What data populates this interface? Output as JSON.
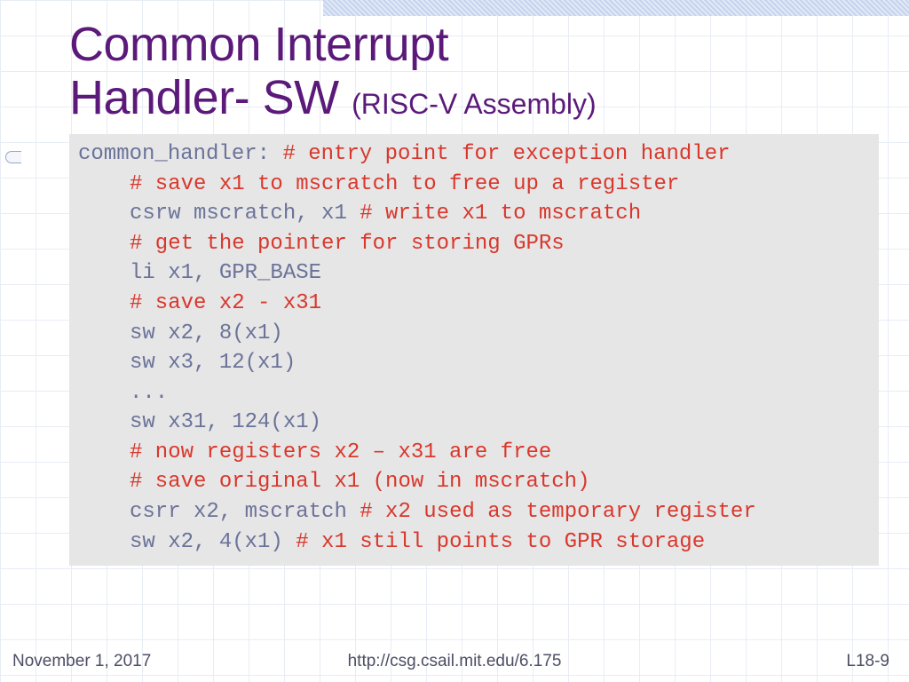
{
  "title": {
    "line1": "Common Interrupt",
    "line2_main": "Handler- SW ",
    "line2_sub": "(RISC-V Assembly)"
  },
  "code": {
    "l1_label": "common_handler: ",
    "l1_cmt": "# entry point for exception handler",
    "l2_cmt": "# save x1 to mscratch to free up a register",
    "l3_instr": "csrw mscratch, x1 ",
    "l3_cmt": "# write x1 to mscratch",
    "l4_cmt": "# get the pointer for storing GPRs",
    "l5_instr": "li x1, GPR_BASE",
    "l6_cmt": "# save x2 - x31",
    "l7_instr": "sw x2, 8(x1)",
    "l8_instr": "sw x3, 12(x1)",
    "l9_instr": "...",
    "l10_instr": "sw x31, 124(x1)",
    "l11_cmt": "# now registers x2 – x31 are free",
    "l12_cmt": "# save original x1 (now in mscratch)",
    "l13_instr": "csrr x2, mscratch ",
    "l13_cmt": "# x2 used as temporary register",
    "l14_instr": "sw x2, 4(x1) ",
    "l14_cmt": "# x1 still points to GPR storage"
  },
  "footer": {
    "date": "November 1, 2017",
    "url": "http://csg.csail.mit.edu/6.175",
    "page": "L18-9"
  }
}
